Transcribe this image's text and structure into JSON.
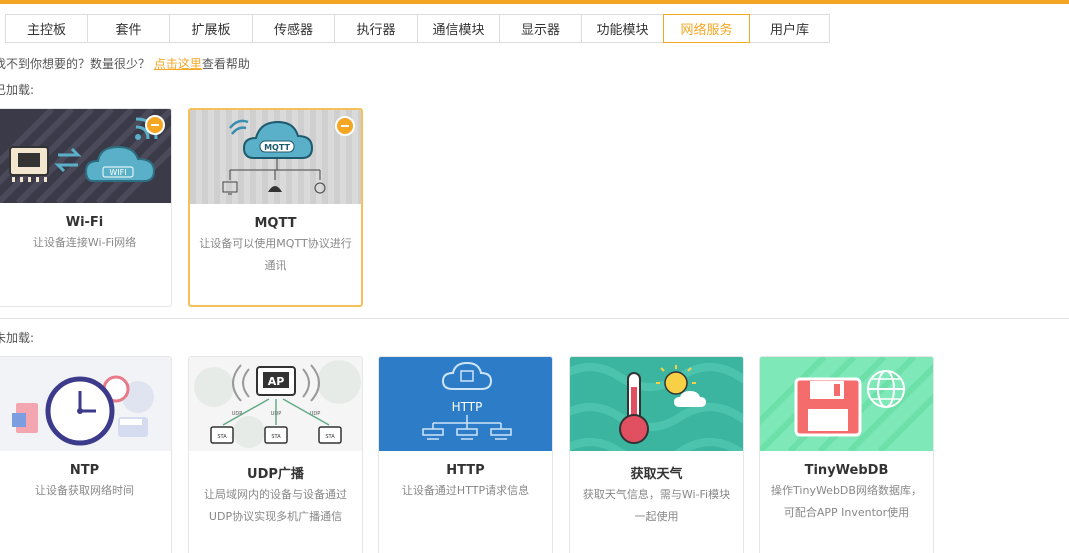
{
  "tabs": [
    {
      "label": "主控板",
      "active": false
    },
    {
      "label": "套件",
      "active": false
    },
    {
      "label": "扩展板",
      "active": false
    },
    {
      "label": "传感器",
      "active": false
    },
    {
      "label": "执行器",
      "active": false
    },
    {
      "label": "通信模块",
      "active": false
    },
    {
      "label": "显示器",
      "active": false
    },
    {
      "label": "功能模块",
      "active": false
    },
    {
      "label": "网络服务",
      "active": true
    },
    {
      "label": "用户库",
      "active": false
    }
  ],
  "help": {
    "prefix": "找不到你想要的？数量很少？",
    "link": "点击这里",
    "suffix": "查看帮助"
  },
  "loaded": {
    "label": "已加载:",
    "cards": [
      {
        "title": "Wi-Fi",
        "desc": "让设备连接Wi-Fi网络"
      },
      {
        "title": "MQTT",
        "desc": "让设备可以使用MQTT协议进行通讯"
      }
    ]
  },
  "unloaded": {
    "label": "未加载:",
    "cards": [
      {
        "title": "NTP",
        "desc": "让设备获取网络时间"
      },
      {
        "title": "UDP广播",
        "desc": "让局域网内的设备与设备通过UDP协议实现多机广播通信"
      },
      {
        "title": "HTTP",
        "desc": "让设备通过HTTP请求信息"
      },
      {
        "title": "获取天气",
        "desc": "获取天气信息，需与Wi-Fi模块一起使用"
      },
      {
        "title": "TinyWebDB",
        "desc": "操作TinyWebDB网络数据库，可配合APP Inventor使用"
      }
    ]
  },
  "thumb_text": {
    "wifi": "WIFI",
    "mqtt": "MQTT",
    "ap": "AP",
    "udp": "UDP",
    "sta": "STA",
    "http": "HTTP"
  },
  "colors": {
    "accent": "#f5a623",
    "wifi_bg": "#3a3a4a",
    "mqtt_bg": "#d8d8d8",
    "http_bg": "#2d7cc7",
    "weather_bg": "#3bb5a0",
    "db_bg": "#7ee8b8"
  }
}
